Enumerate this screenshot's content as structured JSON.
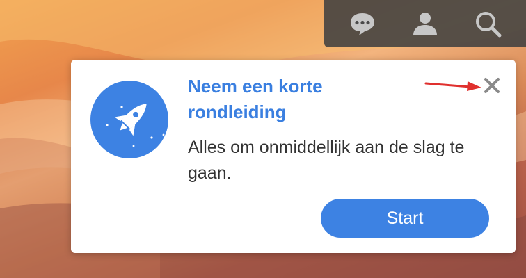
{
  "topbar": {
    "items": [
      {
        "icon": "chat-icon"
      },
      {
        "icon": "user-icon"
      },
      {
        "icon": "search-icon"
      }
    ],
    "icon_color": "#c7c7c7"
  },
  "tour": {
    "title": "Neem een korte rondleiding",
    "description": "Alles om onmiddellijk aan de slag te gaan.",
    "start_label": "Start",
    "close_icon": "close-icon",
    "illustration_icon": "rocket-icon",
    "accent_color": "#3d82e3"
  },
  "annotation": {
    "arrow_color": "#e0302e"
  }
}
